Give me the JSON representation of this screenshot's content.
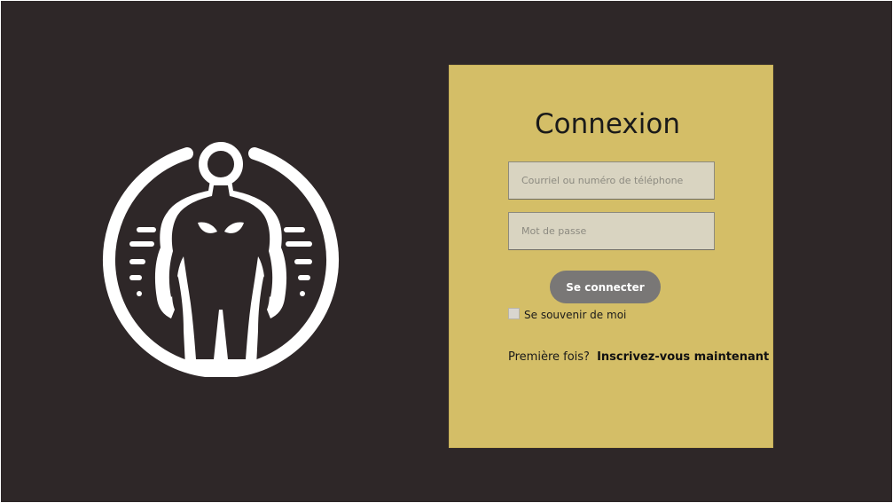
{
  "login": {
    "title": "Connexion",
    "email_placeholder": "Courriel ou numéro de téléphone",
    "password_placeholder": "Mot de passe",
    "submit_label": "Se connecter",
    "remember_label": "Se souvenir de moi",
    "signup_prompt": "Première fois?",
    "signup_link": "Inscrivez-vous maintenant"
  },
  "logo": {
    "icon": "bodybuilder-emblem-icon"
  },
  "colors": {
    "background": "#2e2728",
    "panel": "#d4be67",
    "input": "#d9d4c1",
    "button": "#797776",
    "logo": "#ffffff"
  }
}
